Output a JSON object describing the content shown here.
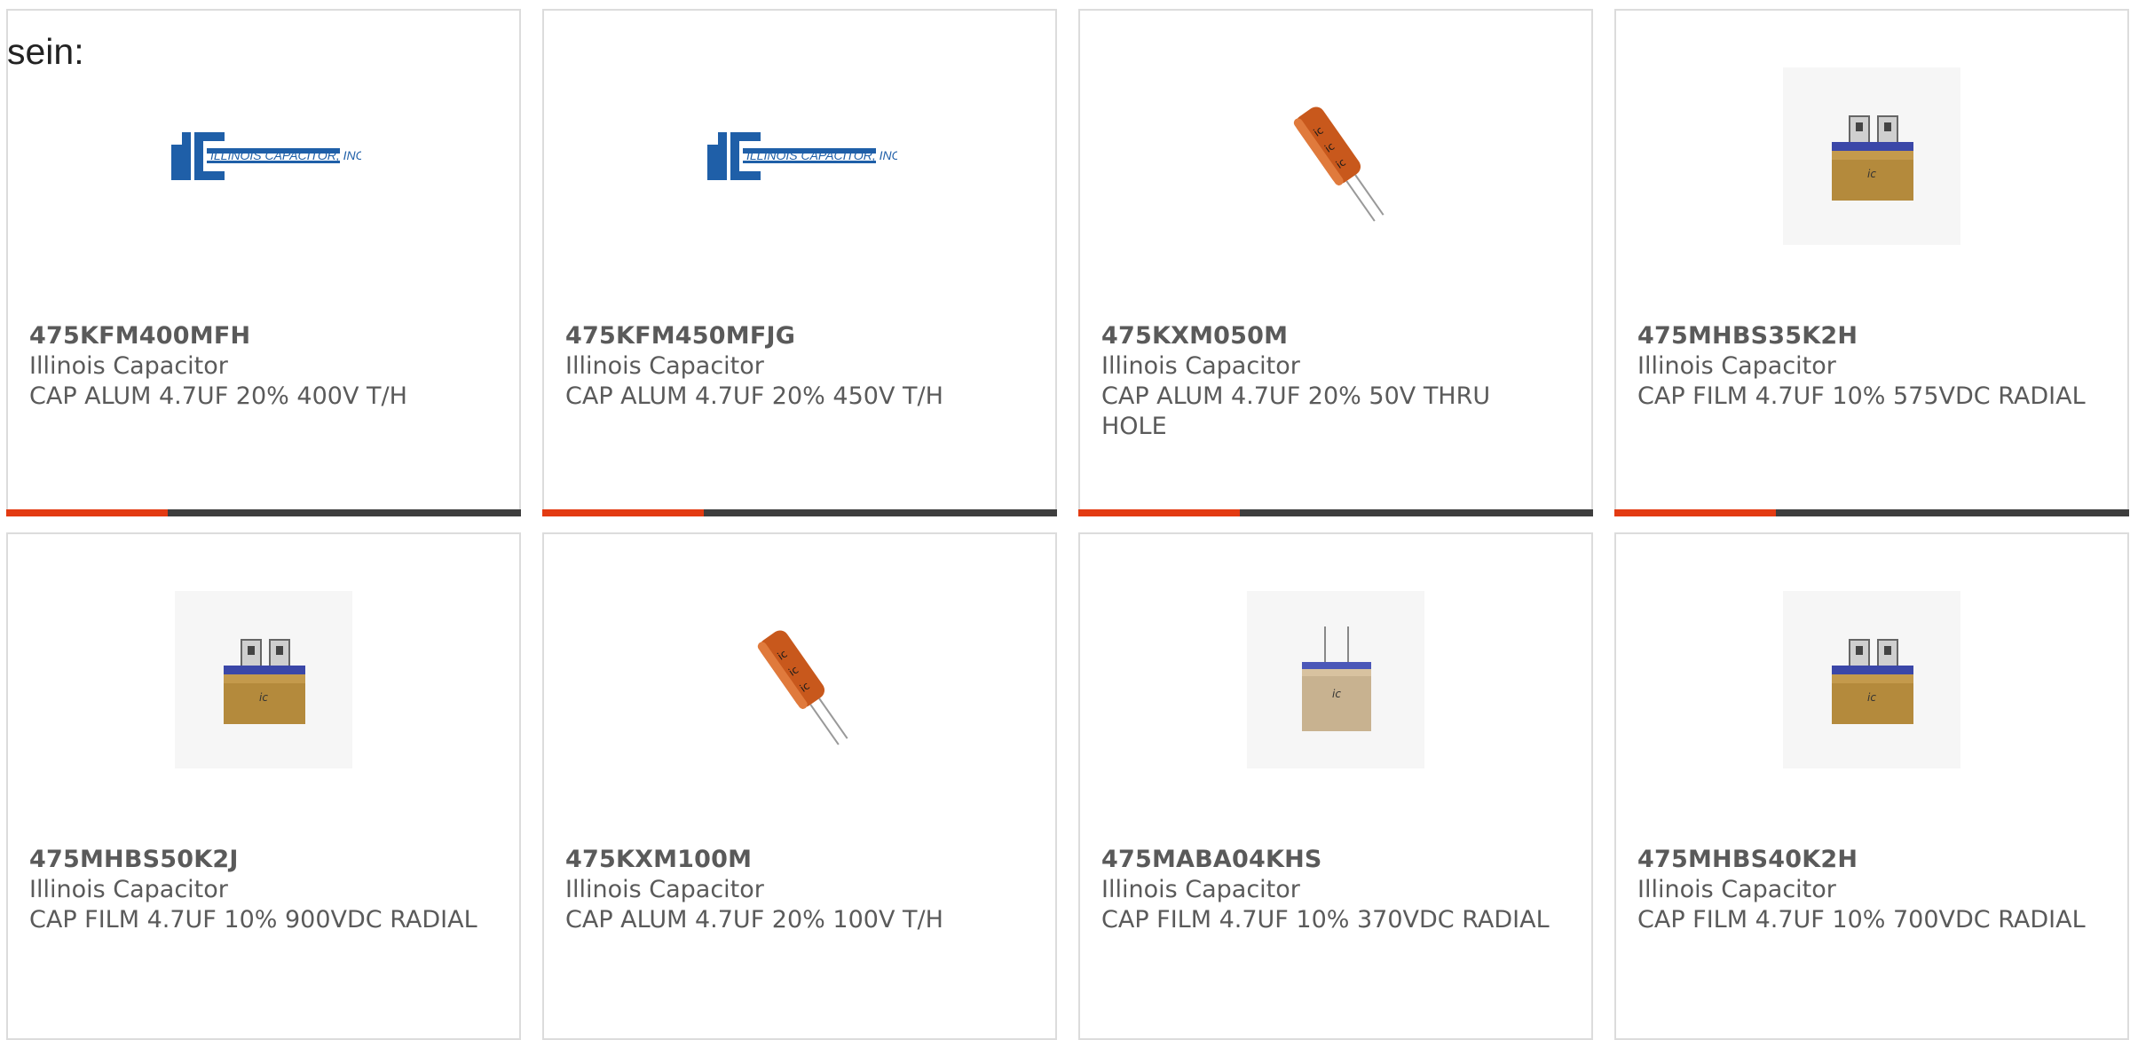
{
  "intro_text": "sein:",
  "products": [
    {
      "part": "475KFM400MFH",
      "mfr": "Illinois Capacitor",
      "desc": "CAP ALUM 4.7UF 20% 400V T/H",
      "image": "ic-logo"
    },
    {
      "part": "475KFM450MFJG",
      "mfr": "Illinois Capacitor",
      "desc": "CAP ALUM 4.7UF 20% 450V T/H",
      "image": "ic-logo"
    },
    {
      "part": "475KXM050M",
      "mfr": "Illinois Capacitor",
      "desc": "CAP ALUM 4.7UF 20% 50V THRU HOLE",
      "image": "electrolytic-capacitor"
    },
    {
      "part": "475MHBS35K2H",
      "mfr": "Illinois Capacitor",
      "desc": "CAP FILM 4.7UF 10% 575VDC RADIAL",
      "image": "film-capacitor-tabs"
    },
    {
      "part": "475MHBS50K2J",
      "mfr": "Illinois Capacitor",
      "desc": "CAP FILM 4.7UF 10% 900VDC RADIAL",
      "image": "film-capacitor-tabs"
    },
    {
      "part": "475KXM100M",
      "mfr": "Illinois Capacitor",
      "desc": "CAP ALUM 4.7UF 20% 100V T/H",
      "image": "electrolytic-capacitor"
    },
    {
      "part": "475MABA04KHS",
      "mfr": "Illinois Capacitor",
      "desc": "CAP FILM 4.7UF 10% 370VDC RADIAL",
      "image": "film-capacitor-leads"
    },
    {
      "part": "475MHBS40K2H",
      "mfr": "Illinois Capacitor",
      "desc": "CAP FILM 4.7UF 10% 700VDC RADIAL",
      "image": "film-capacitor-tabs"
    }
  ],
  "logo_text": {
    "brand": "IC",
    "name": "ILLINOIS CAPACITOR, INC.",
    "mark": "ic"
  },
  "colors": {
    "accent": "#e33b12",
    "bar": "#3e3e3e",
    "logo_blue": "#1f5fa8",
    "cap_orange": "#c8581c"
  }
}
